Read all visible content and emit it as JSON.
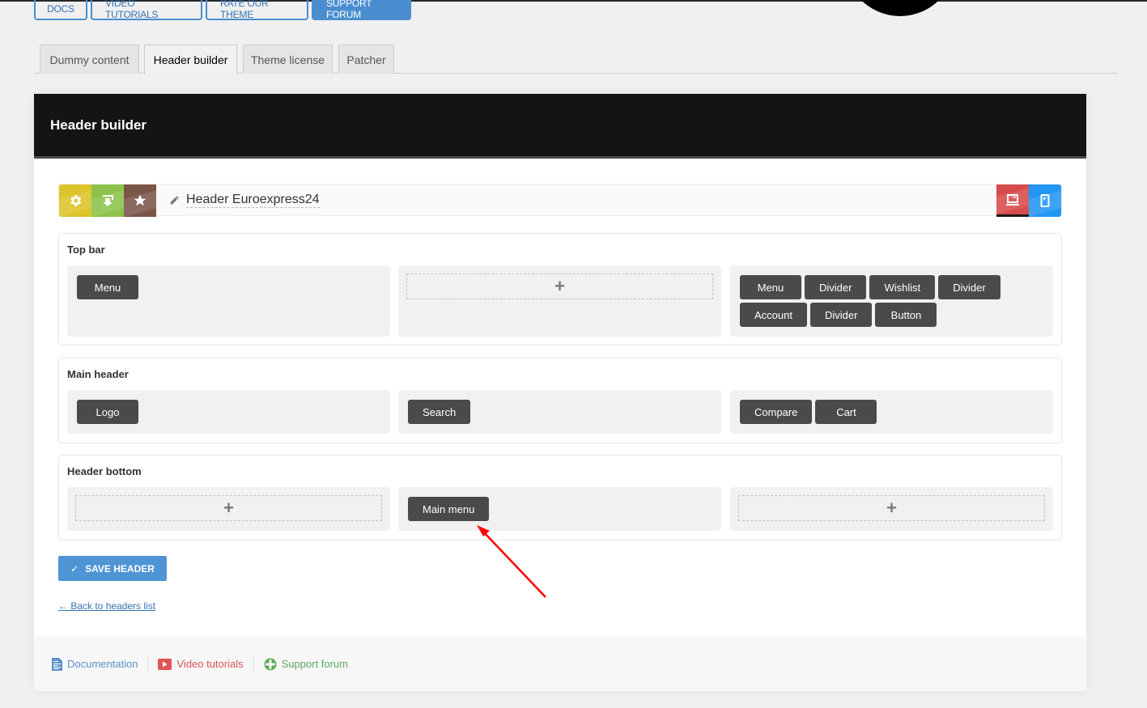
{
  "top_links": [
    {
      "label": "DOCS",
      "primary": false
    },
    {
      "label": "VIDEO TUTORIALS",
      "primary": false
    },
    {
      "label": "RATE OUR THEME",
      "primary": false
    },
    {
      "label": "SUPPORT FORUM",
      "primary": true
    }
  ],
  "tabs": [
    {
      "label": "Dummy content",
      "active": false
    },
    {
      "label": "Header builder",
      "active": true
    },
    {
      "label": "Theme license",
      "active": false
    },
    {
      "label": "Patcher",
      "active": false
    }
  ],
  "panel": {
    "title": "Header builder"
  },
  "toolbar": {
    "header_name": "Header Euroexpress24",
    "icons": [
      "gear-icon",
      "import-icon",
      "star-icon",
      "pencil-icon",
      "desktop-icon",
      "mobile-icon"
    ],
    "colors": {
      "gear": "#dcc42a",
      "import": "#8bc34a",
      "star": "#7b5548",
      "desktop": "#d94b4b",
      "mobile": "#2196f3"
    }
  },
  "rows": [
    {
      "title": "Top bar",
      "columns": [
        [
          "Menu"
        ],
        [],
        [
          "Menu",
          "Divider",
          "Wishlist",
          "Divider",
          "Account",
          "Divider",
          "Button"
        ]
      ]
    },
    {
      "title": "Main header",
      "columns": [
        [
          "Logo"
        ],
        [
          "Search"
        ],
        [
          "Compare",
          "Cart"
        ]
      ]
    },
    {
      "title": "Header bottom",
      "columns": [
        [],
        [
          "Main menu"
        ],
        []
      ]
    }
  ],
  "add_symbol": "+",
  "save_button": {
    "check": "✓",
    "label": "SAVE HEADER",
    "color": "#4f94d4"
  },
  "back_link": "← Back to headers list",
  "footer": {
    "documentation": "Documentation",
    "video_tutorials": "Video tutorials",
    "support_forum": "Support forum"
  },
  "annotation": {
    "type": "arrow",
    "color": "#ff0000",
    "points_to": "Main menu"
  }
}
